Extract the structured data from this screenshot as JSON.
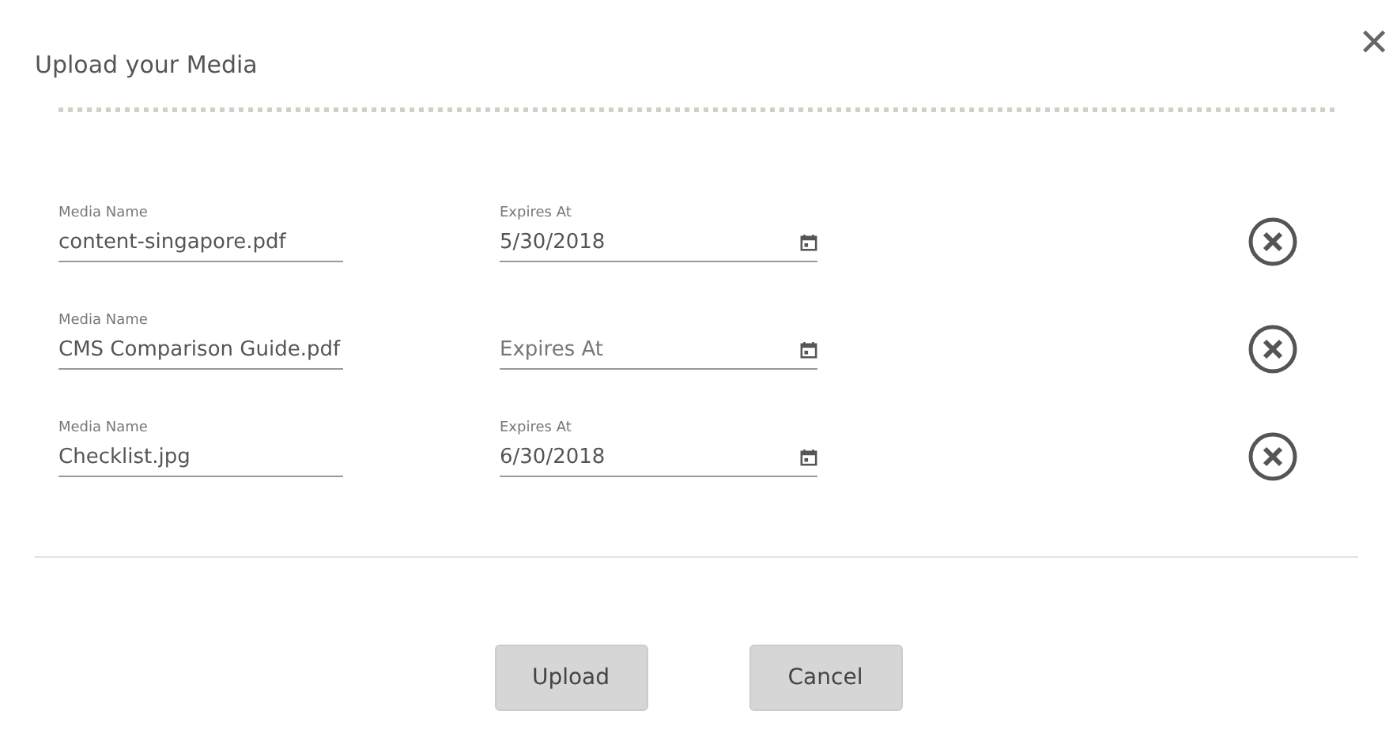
{
  "dialog": {
    "title": "Upload your Media",
    "close_symbol": "✕"
  },
  "media": [
    {
      "name": {
        "label": "Media Name",
        "value": "content-singapore.pdf"
      },
      "expires": {
        "label": "Expires At",
        "value": "5/30/2018"
      }
    },
    {
      "name": {
        "label": "Media Name",
        "value": "CMS Comparison Guide.pdf"
      },
      "expires": {
        "placeholder": "Expires At"
      }
    },
    {
      "name": {
        "label": "Media Name",
        "value": "Checklist.jpg"
      },
      "expires": {
        "label": "Expires At",
        "value": "6/30/2018"
      }
    }
  ],
  "buttons": [
    "Upload",
    "Cancel"
  ]
}
